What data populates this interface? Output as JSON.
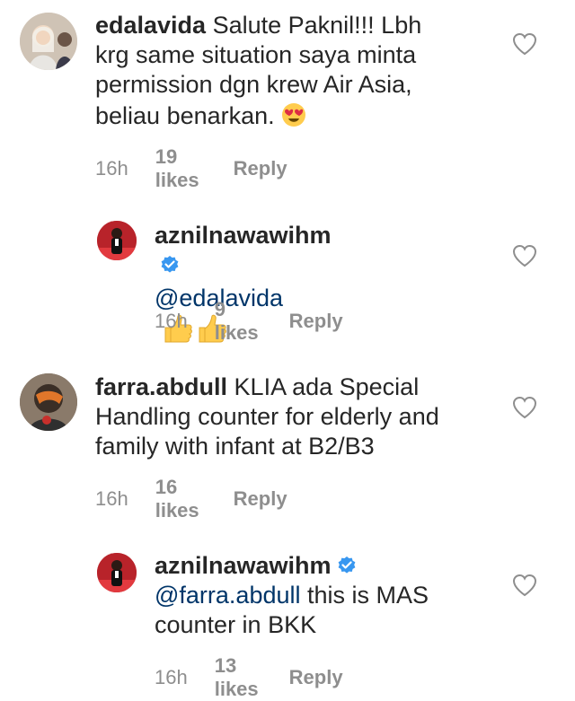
{
  "comments": [
    {
      "username": "edalavida",
      "line1": " Salute Paknil!!! Lbh",
      "line2": "krg same situation saya minta",
      "line3": "permission dgn krew Air Asia,",
      "line4": "beliau benarkan. ",
      "emoji": "heart-eyes",
      "time": "16h",
      "likes": "19 likes",
      "reply": "Reply"
    },
    {
      "username": "aznilnawawihm",
      "verified": true,
      "mention": "@edalavida",
      "emoji": "thumbs-up",
      "time": "16h",
      "likes": "9 likes",
      "reply": "Reply"
    },
    {
      "username": "farra.abdull",
      "line1": " KLIA ada Special",
      "line2": "Handling counter for elderly and",
      "line3": "family with infant at B2/B3",
      "time": "16h",
      "likes": "16 likes",
      "reply": "Reply"
    },
    {
      "username": "aznilnawawihm",
      "verified": true,
      "mention": "@farra.abdull",
      "line1": " this is MAS",
      "line2": "counter in BKK",
      "time": "16h",
      "likes": "13 likes",
      "reply": "Reply"
    }
  ],
  "colors": {
    "text": "#262626",
    "meta": "#8e8e8e",
    "mention": "#003569",
    "verified": "#3897f0"
  }
}
